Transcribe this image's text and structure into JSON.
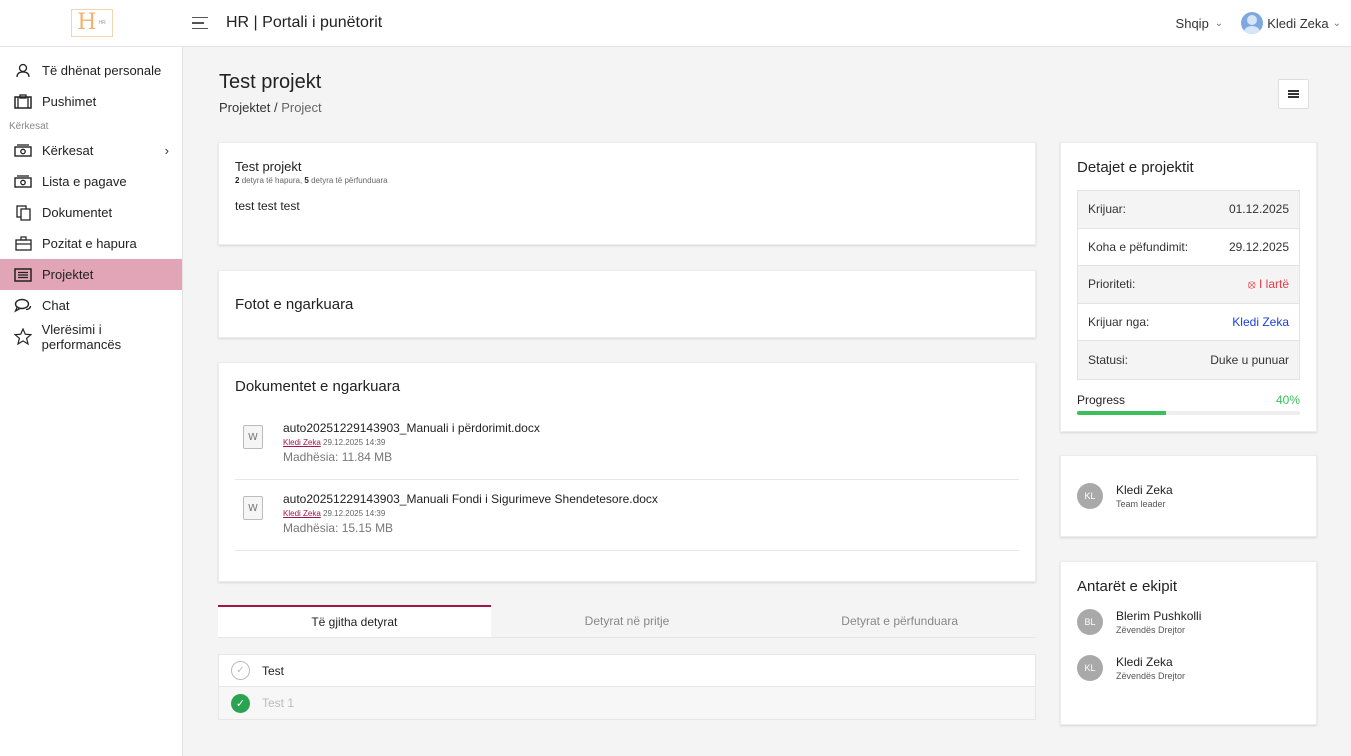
{
  "topbar": {
    "title": "HR | Portali i punëtorit",
    "language": "Shqip",
    "user_name": "Kledi Zeka"
  },
  "sidebar": {
    "items": [
      {
        "label": "Të dhënat personale",
        "icon": "user-icon"
      },
      {
        "label": "Pushimet",
        "icon": "briefcase-icon"
      },
      {
        "section": "Kërkesat"
      },
      {
        "label": "Kërkesat",
        "icon": "money-icon"
      },
      {
        "label": "Lista e pagave",
        "icon": "money-icon"
      },
      {
        "label": "Dokumentet",
        "icon": "documents-icon"
      },
      {
        "label": "Pozitat e hapura",
        "icon": "briefcase-open-icon"
      },
      {
        "label": "Projektet",
        "icon": "list-icon",
        "active": true
      },
      {
        "label": "Chat",
        "icon": "chat-icon"
      },
      {
        "label": "Vlerësimi i performancës",
        "icon": "star-icon"
      }
    ]
  },
  "page": {
    "title": "Test projekt",
    "breadcrumb_parent": "Projektet",
    "breadcrumb_sep": "/",
    "breadcrumb_current": "Project"
  },
  "project": {
    "name": "Test projekt",
    "open_count": "2",
    "open_label": "detyra të hapura,",
    "done_count": "5",
    "done_label": "detyra të përfunduara",
    "description": "test test test"
  },
  "photos": {
    "heading": "Fotot e ngarkuara"
  },
  "documents": {
    "heading": "Dokumentet e ngarkuara",
    "items": [
      {
        "name": "auto20251229143903_Manuali i përdorimit.docx",
        "author": "Kledi Zeka",
        "date": "29.12.2025 14:39",
        "size": "Madhësia: 11.84 MB"
      },
      {
        "name": "auto20251229143903_Manuali Fondi i Sigurimeve Shendetesore.docx",
        "author": "Kledi Zeka",
        "date": "29.12.2025 14:39",
        "size": "Madhësia: 15.15 MB"
      }
    ]
  },
  "tabs": [
    "Të gjitha detyrat",
    "Detyrat në pritje",
    "Detyrat e përfunduara"
  ],
  "tasks": [
    {
      "label": "Test",
      "done": false
    },
    {
      "label": "Test 1",
      "done": true
    }
  ],
  "details": {
    "heading": "Detajet e projektit",
    "rows": [
      {
        "label": "Krijuar:",
        "value": "01.12.2025"
      },
      {
        "label": "Koha e pëfundimit:",
        "value": "29.12.2025"
      },
      {
        "label": "Prioriteti:",
        "value": "I lartë"
      },
      {
        "label": "Krijuar nga:",
        "value": "Kledi Zeka"
      },
      {
        "label": "Statusi:",
        "value": "Duke u punuar"
      }
    ],
    "progress_label": "Progress",
    "progress_value": "40%",
    "progress_fraction": 0.4
  },
  "leader": {
    "initials": "KL",
    "name": "Kledi Zeka",
    "role": "Team leader"
  },
  "team": {
    "heading": "Antarët e ekipit",
    "members": [
      {
        "initials": "BL",
        "name": "Blerim Pushkolli",
        "role": "Zëvendës Drejtor"
      },
      {
        "initials": "KL",
        "name": "Kledi Zeka",
        "role": "Zëvendës Drejtor"
      }
    ]
  },
  "colors": {
    "accent": "#a3154a",
    "active_nav": "#e2a5b8",
    "progress": "#3bbf5a",
    "priority_high": "#e63946",
    "link": "#1a3fe0"
  }
}
